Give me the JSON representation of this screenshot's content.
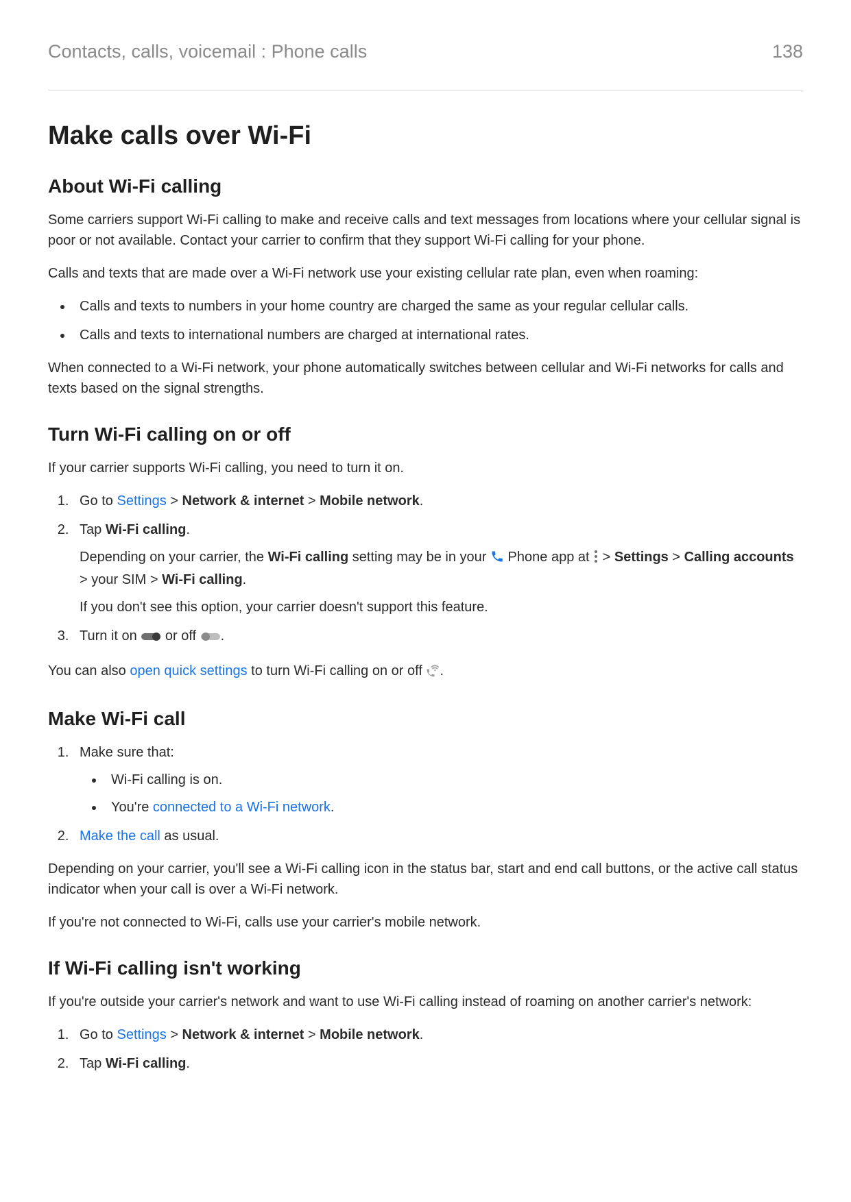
{
  "header": {
    "breadcrumb": "Contacts, calls, voicemail : Phone calls",
    "page_number": "138"
  },
  "title": "Make calls over Wi-Fi",
  "about": {
    "heading": "About Wi-Fi calling",
    "p1": "Some carriers support Wi-Fi calling to make and receive calls and text messages from locations where your cellular signal is poor or not available. Contact your carrier to confirm that they support Wi-Fi calling for your phone.",
    "p2": "Calls and texts that are made over a Wi-Fi network use your existing cellular rate plan, even when roaming:",
    "b1": "Calls and texts to numbers in your home country are charged the same as your regular cellular calls.",
    "b2": "Calls and texts to international numbers are charged at international rates.",
    "p3": "When connected to a Wi-Fi network, your phone automatically switches between cellular and Wi-Fi networks for calls and texts based on the signal strengths."
  },
  "turn": {
    "heading": "Turn Wi-Fi calling on or off",
    "p1": "If your carrier supports Wi-Fi calling, you need to turn it on.",
    "s1_pre": "Go to ",
    "s1_link": "Settings",
    "s1_sep1": " > ",
    "s1_b1": "Network & internet",
    "s1_sep2": " > ",
    "s1_b2": "Mobile network",
    "s1_end": ".",
    "s2_pre": "Tap ",
    "s2_b": "Wi-Fi calling",
    "s2_end": ".",
    "s2_sub_pre": "Depending on your carrier, the ",
    "s2_sub_b1": "Wi-Fi calling",
    "s2_sub_mid1": " setting may be in your ",
    "s2_sub_mid2": " Phone app at ",
    "s2_sub_sep1": " > ",
    "s2_sub_b2": "Settings",
    "s2_sub_sep2": " > ",
    "s2_sub_b3": "Calling accounts",
    "s2_sub_sep3": " > your SIM > ",
    "s2_sub_b4": "Wi-Fi calling",
    "s2_sub_end": ".",
    "s2_note": "If you don't see this option, your carrier doesn't support this feature.",
    "s3_pre": "Turn it on ",
    "s3_mid": " or off ",
    "s3_end": ".",
    "p2_pre": "You can also ",
    "p2_link": "open quick settings",
    "p2_mid": " to turn Wi-Fi calling on or off ",
    "p2_end": "."
  },
  "make": {
    "heading": "Make Wi-Fi call",
    "s1": "Make sure that:",
    "s1_b1": "Wi-Fi calling is on.",
    "s1_b2_pre": "You're ",
    "s1_b2_link": "connected to a Wi-Fi network",
    "s1_b2_end": ".",
    "s2_link": "Make the call",
    "s2_end": " as usual.",
    "p1": "Depending on your carrier, you'll see a Wi-Fi calling icon in the status bar, start and end call buttons, or the active call status indicator when your call is over a Wi-Fi network.",
    "p2": "If you're not connected to Wi-Fi, calls use your carrier's mobile network."
  },
  "trouble": {
    "heading": "If Wi-Fi calling isn't working",
    "p1": "If you're outside your carrier's network and want to use Wi-Fi calling instead of roaming on another carrier's network:",
    "s1_pre": "Go to ",
    "s1_link": "Settings",
    "s1_sep1": " > ",
    "s1_b1": "Network & internet",
    "s1_sep2": " > ",
    "s1_b2": "Mobile network",
    "s1_end": ".",
    "s2_pre": "Tap ",
    "s2_b": "Wi-Fi calling",
    "s2_end": "."
  }
}
